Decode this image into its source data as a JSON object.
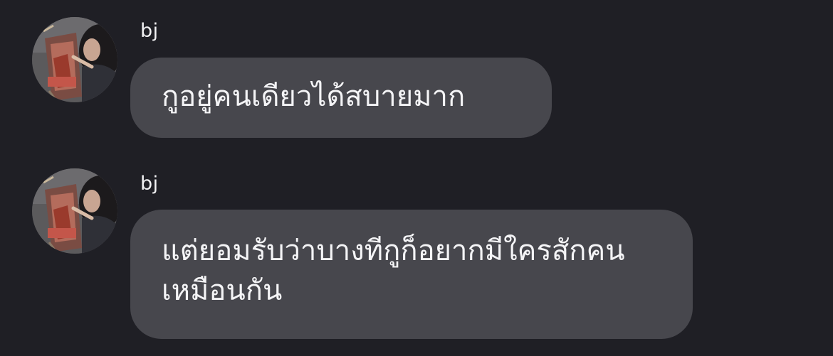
{
  "conversation": {
    "messages": [
      {
        "sender": "bj",
        "text": "กูอยู่คนเดียวได้สบายมาก",
        "avatar_icon": "user-avatar-painting"
      },
      {
        "sender": "bj",
        "text": "แต่ยอมรับว่าบางทีกูก็อยากมีใครสักคนเหมือนกัน",
        "avatar_icon": "user-avatar-painting"
      }
    ]
  },
  "colors": {
    "background": "#1f1f25",
    "bubble": "#47474d",
    "text": "#f4f4f6"
  }
}
